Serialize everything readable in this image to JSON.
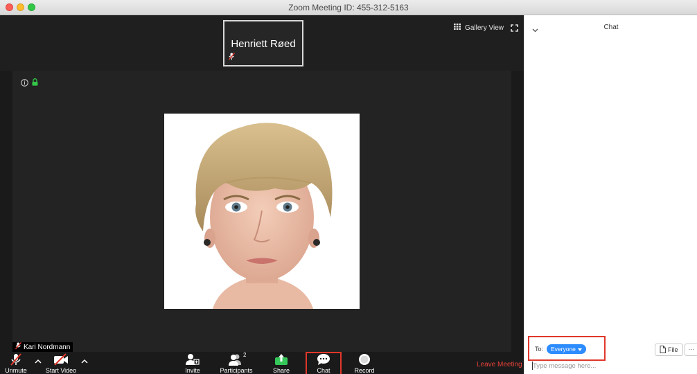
{
  "window": {
    "title": "Zoom Meeting ID: 455-312-5163"
  },
  "top_strip": {
    "thumbnail_name": "Henriett Røed",
    "gallery_label": "Gallery View"
  },
  "stage": {
    "self_name": "Kari Nordmann"
  },
  "controls": {
    "unmute": "Unmute",
    "start_video": "Start Video",
    "invite": "Invite",
    "participants": "Participants",
    "participants_count": "2",
    "share": "Share",
    "chat": "Chat",
    "record": "Record",
    "leave": "Leave Meeting"
  },
  "chat_panel": {
    "title": "Chat",
    "to_label": "To:",
    "recipient": "Everyone",
    "file_label": "File",
    "more_label": "···",
    "message_placeholder": "Type message here..."
  },
  "colors": {
    "accent_blue": "#2d8cff",
    "highlight_red": "#e0372a",
    "leave_red": "#e8433a",
    "share_green": "#35c759"
  }
}
